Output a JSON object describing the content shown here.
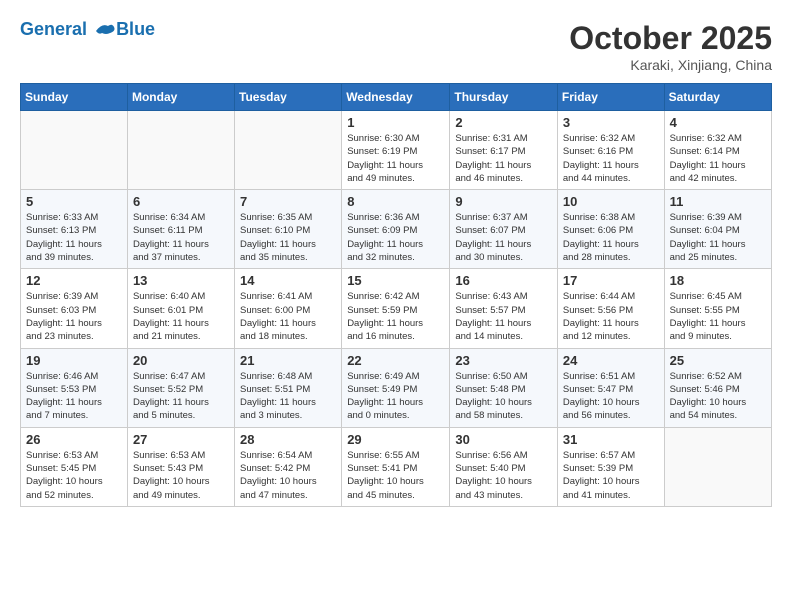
{
  "header": {
    "logo_line1": "General",
    "logo_line2": "Blue",
    "month": "October 2025",
    "location": "Karaki, Xinjiang, China"
  },
  "weekdays": [
    "Sunday",
    "Monday",
    "Tuesday",
    "Wednesday",
    "Thursday",
    "Friday",
    "Saturday"
  ],
  "weeks": [
    [
      {
        "day": "",
        "info": ""
      },
      {
        "day": "",
        "info": ""
      },
      {
        "day": "",
        "info": ""
      },
      {
        "day": "1",
        "info": "Sunrise: 6:30 AM\nSunset: 6:19 PM\nDaylight: 11 hours\nand 49 minutes."
      },
      {
        "day": "2",
        "info": "Sunrise: 6:31 AM\nSunset: 6:17 PM\nDaylight: 11 hours\nand 46 minutes."
      },
      {
        "day": "3",
        "info": "Sunrise: 6:32 AM\nSunset: 6:16 PM\nDaylight: 11 hours\nand 44 minutes."
      },
      {
        "day": "4",
        "info": "Sunrise: 6:32 AM\nSunset: 6:14 PM\nDaylight: 11 hours\nand 42 minutes."
      }
    ],
    [
      {
        "day": "5",
        "info": "Sunrise: 6:33 AM\nSunset: 6:13 PM\nDaylight: 11 hours\nand 39 minutes."
      },
      {
        "day": "6",
        "info": "Sunrise: 6:34 AM\nSunset: 6:11 PM\nDaylight: 11 hours\nand 37 minutes."
      },
      {
        "day": "7",
        "info": "Sunrise: 6:35 AM\nSunset: 6:10 PM\nDaylight: 11 hours\nand 35 minutes."
      },
      {
        "day": "8",
        "info": "Sunrise: 6:36 AM\nSunset: 6:09 PM\nDaylight: 11 hours\nand 32 minutes."
      },
      {
        "day": "9",
        "info": "Sunrise: 6:37 AM\nSunset: 6:07 PM\nDaylight: 11 hours\nand 30 minutes."
      },
      {
        "day": "10",
        "info": "Sunrise: 6:38 AM\nSunset: 6:06 PM\nDaylight: 11 hours\nand 28 minutes."
      },
      {
        "day": "11",
        "info": "Sunrise: 6:39 AM\nSunset: 6:04 PM\nDaylight: 11 hours\nand 25 minutes."
      }
    ],
    [
      {
        "day": "12",
        "info": "Sunrise: 6:39 AM\nSunset: 6:03 PM\nDaylight: 11 hours\nand 23 minutes."
      },
      {
        "day": "13",
        "info": "Sunrise: 6:40 AM\nSunset: 6:01 PM\nDaylight: 11 hours\nand 21 minutes."
      },
      {
        "day": "14",
        "info": "Sunrise: 6:41 AM\nSunset: 6:00 PM\nDaylight: 11 hours\nand 18 minutes."
      },
      {
        "day": "15",
        "info": "Sunrise: 6:42 AM\nSunset: 5:59 PM\nDaylight: 11 hours\nand 16 minutes."
      },
      {
        "day": "16",
        "info": "Sunrise: 6:43 AM\nSunset: 5:57 PM\nDaylight: 11 hours\nand 14 minutes."
      },
      {
        "day": "17",
        "info": "Sunrise: 6:44 AM\nSunset: 5:56 PM\nDaylight: 11 hours\nand 12 minutes."
      },
      {
        "day": "18",
        "info": "Sunrise: 6:45 AM\nSunset: 5:55 PM\nDaylight: 11 hours\nand 9 minutes."
      }
    ],
    [
      {
        "day": "19",
        "info": "Sunrise: 6:46 AM\nSunset: 5:53 PM\nDaylight: 11 hours\nand 7 minutes."
      },
      {
        "day": "20",
        "info": "Sunrise: 6:47 AM\nSunset: 5:52 PM\nDaylight: 11 hours\nand 5 minutes."
      },
      {
        "day": "21",
        "info": "Sunrise: 6:48 AM\nSunset: 5:51 PM\nDaylight: 11 hours\nand 3 minutes."
      },
      {
        "day": "22",
        "info": "Sunrise: 6:49 AM\nSunset: 5:49 PM\nDaylight: 11 hours\nand 0 minutes."
      },
      {
        "day": "23",
        "info": "Sunrise: 6:50 AM\nSunset: 5:48 PM\nDaylight: 10 hours\nand 58 minutes."
      },
      {
        "day": "24",
        "info": "Sunrise: 6:51 AM\nSunset: 5:47 PM\nDaylight: 10 hours\nand 56 minutes."
      },
      {
        "day": "25",
        "info": "Sunrise: 6:52 AM\nSunset: 5:46 PM\nDaylight: 10 hours\nand 54 minutes."
      }
    ],
    [
      {
        "day": "26",
        "info": "Sunrise: 6:53 AM\nSunset: 5:45 PM\nDaylight: 10 hours\nand 52 minutes."
      },
      {
        "day": "27",
        "info": "Sunrise: 6:53 AM\nSunset: 5:43 PM\nDaylight: 10 hours\nand 49 minutes."
      },
      {
        "day": "28",
        "info": "Sunrise: 6:54 AM\nSunset: 5:42 PM\nDaylight: 10 hours\nand 47 minutes."
      },
      {
        "day": "29",
        "info": "Sunrise: 6:55 AM\nSunset: 5:41 PM\nDaylight: 10 hours\nand 45 minutes."
      },
      {
        "day": "30",
        "info": "Sunrise: 6:56 AM\nSunset: 5:40 PM\nDaylight: 10 hours\nand 43 minutes."
      },
      {
        "day": "31",
        "info": "Sunrise: 6:57 AM\nSunset: 5:39 PM\nDaylight: 10 hours\nand 41 minutes."
      },
      {
        "day": "",
        "info": ""
      }
    ]
  ]
}
